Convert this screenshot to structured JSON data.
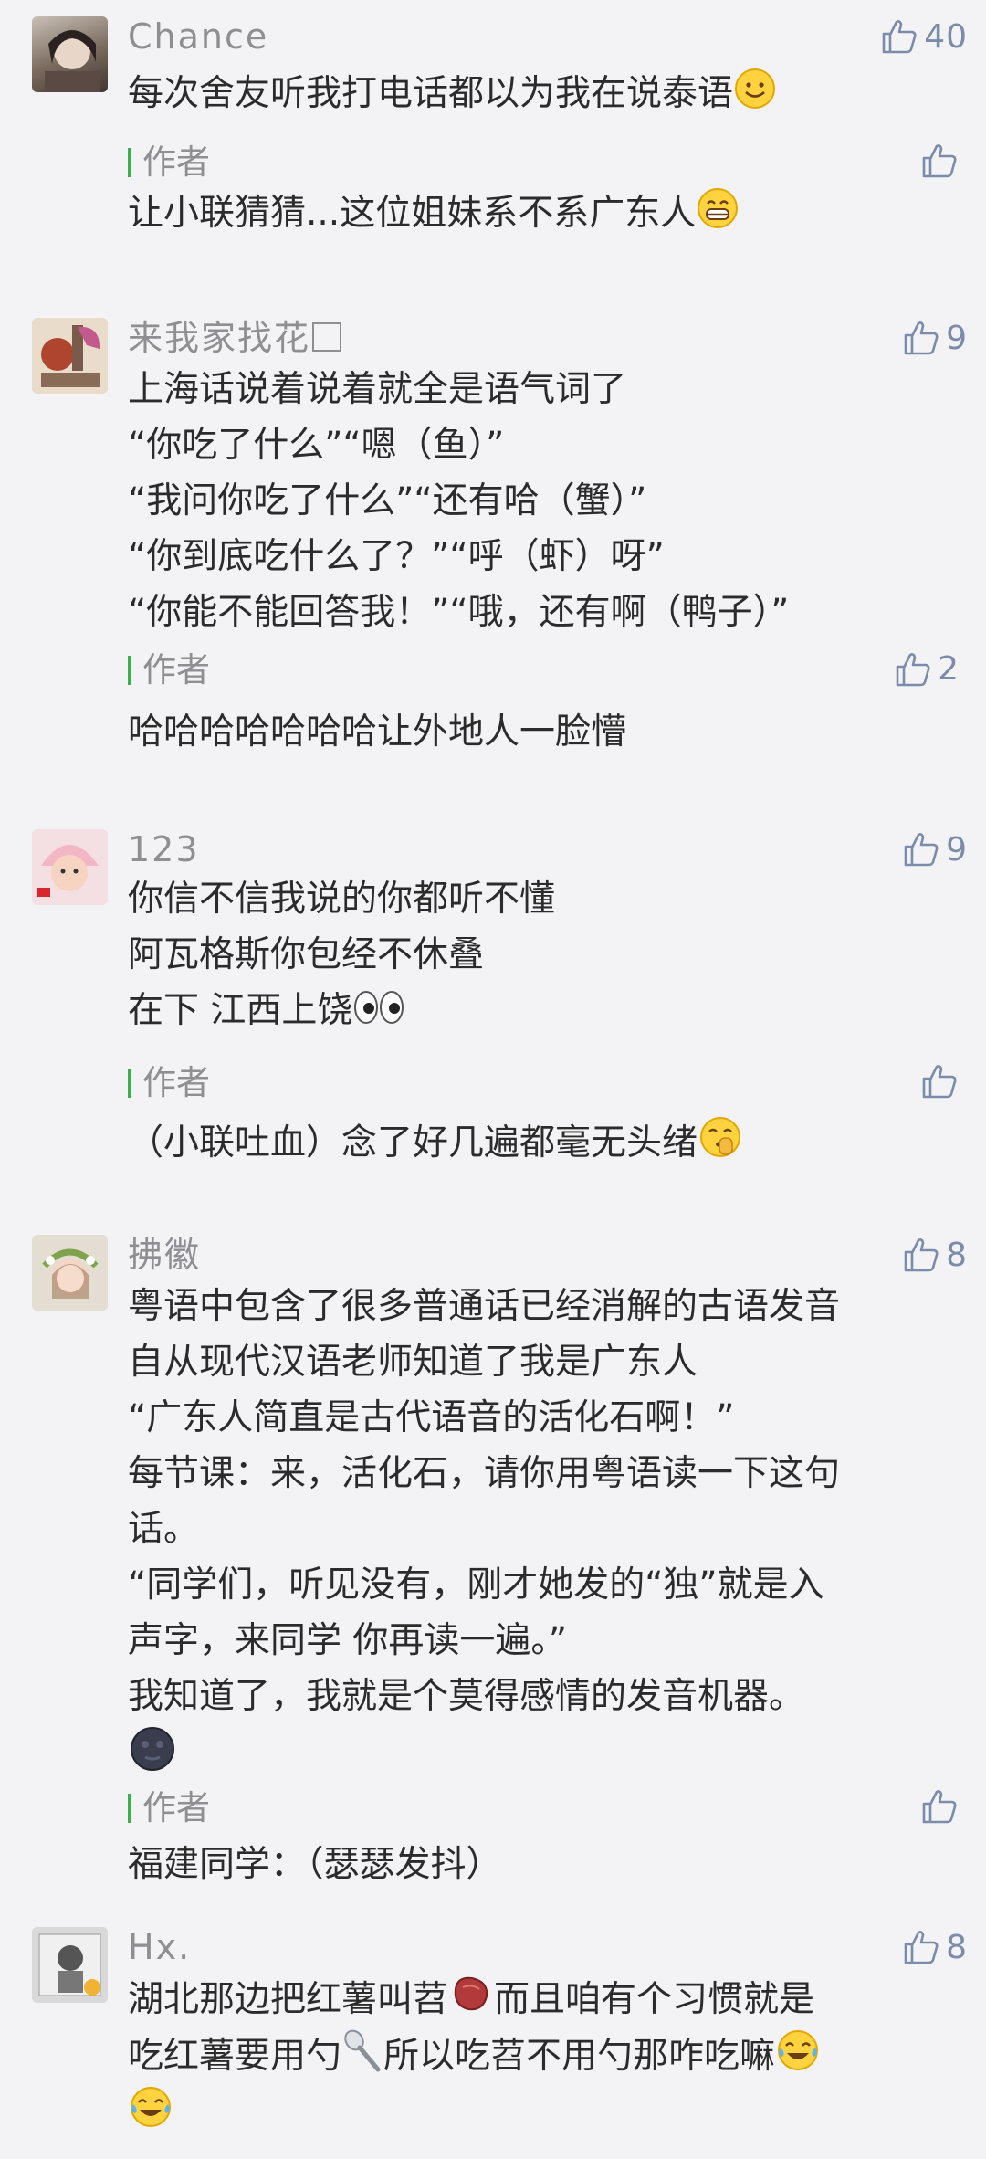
{
  "comments": [
    {
      "nickname": "Chance",
      "likes": "40",
      "lines": [
        "每次舍友听我打电话都以为我在说泰语"
      ],
      "emoji_after_last": "smile",
      "author": {
        "label": "作者",
        "likes": "",
        "text": "让小联猜猜...这位姐妹系不系广东人",
        "emoji": "grin"
      }
    },
    {
      "nickname": "来我家找花",
      "likes": "9",
      "lines": [
        "上海话说着说着就全是语气词了",
        "“你吃了什么”“嗯（鱼）”",
        "“我问你吃了什么”“还有哈（蟹）”",
        "“你到底吃什么了？”“呼（虾）呀”",
        "“你能不能回答我！”“哦，还有啊（鸭子）”"
      ],
      "author": {
        "label": "作者",
        "likes": "2",
        "text": "哈哈哈哈哈哈哈让外地人一脸懵"
      }
    },
    {
      "nickname": "123",
      "likes": "9",
      "lines": [
        "你信不信我说的你都听不懂",
        "阿瓦格斯你包经不休叠",
        "在下 江西上饶"
      ],
      "emoji_after_last": "eyes",
      "author": {
        "label": "作者",
        "likes": "",
        "text": "（小联吐血）念了好几遍都毫无头绪",
        "emoji": "shush"
      }
    },
    {
      "nickname": "拂徽",
      "likes": "8",
      "lines": [
        "粤语中包含了很多普通话已经消解的古语发音",
        "自从现代汉语老师知道了我是广东人",
        "“广东人简直是古代语音的活化石啊！”",
        "每节课：来，活化石，请你用粤语读一下这句",
        "话。",
        "“同学们，听见没有，刚才她发的“独”就是入",
        "声字，来同学 你再读一遍。”",
        "我知道了，我就是个莫得感情的发音机器。"
      ],
      "emoji_line": "moon",
      "author": {
        "label": "作者",
        "likes": "",
        "text": "福建同学：（瑟瑟发抖）"
      }
    },
    {
      "nickname": "Hx.",
      "likes": "8",
      "line1": "湖北那边把红薯叫苕",
      "line1b": "而且咱有个习惯就是",
      "line2": "吃红薯要用勺",
      "line2b": "所以吃苕不用勺那咋吃嘛"
    }
  ],
  "colors": {
    "background": "#f3f3f5",
    "nickname": "#8e8e93",
    "like": "#7b8cab",
    "author_bar": "#3bb04a",
    "text": "#2b2b2b"
  }
}
